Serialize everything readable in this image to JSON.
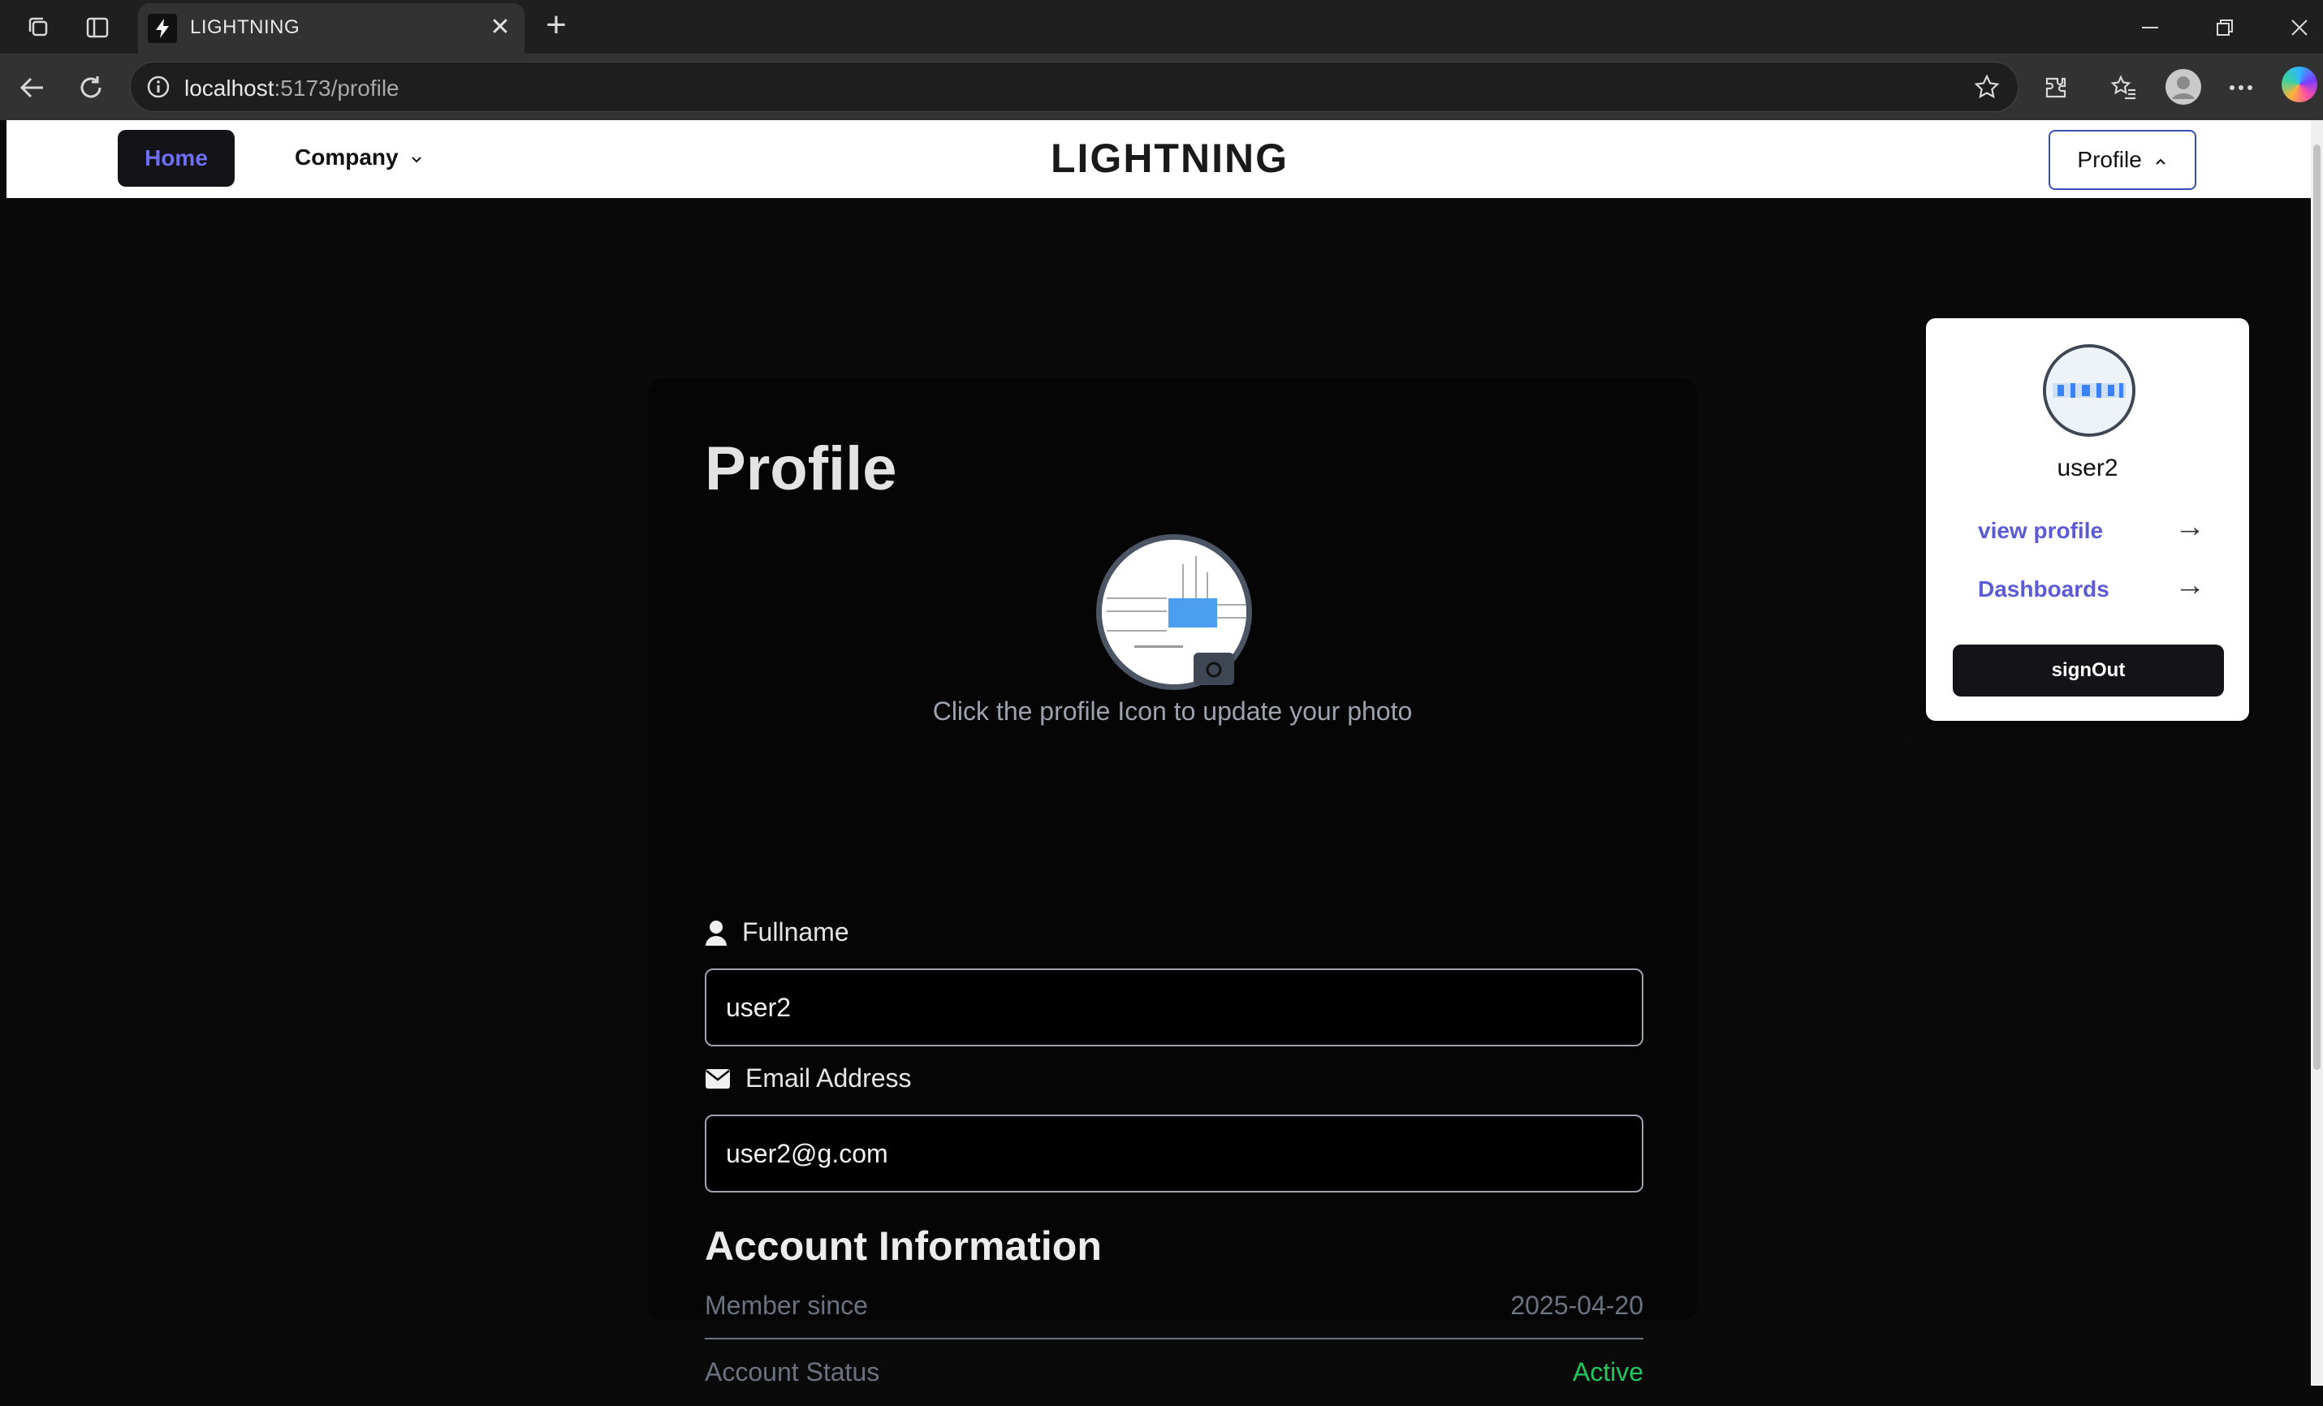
{
  "browser": {
    "tab_title": "LIGHTNING",
    "url_host": "localhost",
    "url_path": ":5173/profile",
    "tab_close": "✕",
    "new_tab": "+"
  },
  "navbar": {
    "home_label": "Home",
    "company_label": "Company",
    "brand": "LIGHTNING",
    "profile_label": "Profile"
  },
  "dropdown": {
    "username": "user2",
    "view_profile": "view profile",
    "dashboards": "Dashboards",
    "signout": "signOut",
    "arrow": "→"
  },
  "profile": {
    "title": "Profile",
    "hint": "Click the profile Icon to update your photo",
    "fullname_label": "Fullname",
    "fullname_value": "user2",
    "email_label": "Email Address",
    "email_value": "user2@g.com"
  },
  "account": {
    "title": "Account Information",
    "member_since_label": "Member since",
    "member_since_value": "2025-04-20",
    "status_label": "Account Status",
    "status_value": "Active",
    "status_color": "#22c55e"
  },
  "colors": {
    "accent": "#6d6df5",
    "link": "#5b5bd6",
    "page_bg": "#0a0a0a"
  }
}
